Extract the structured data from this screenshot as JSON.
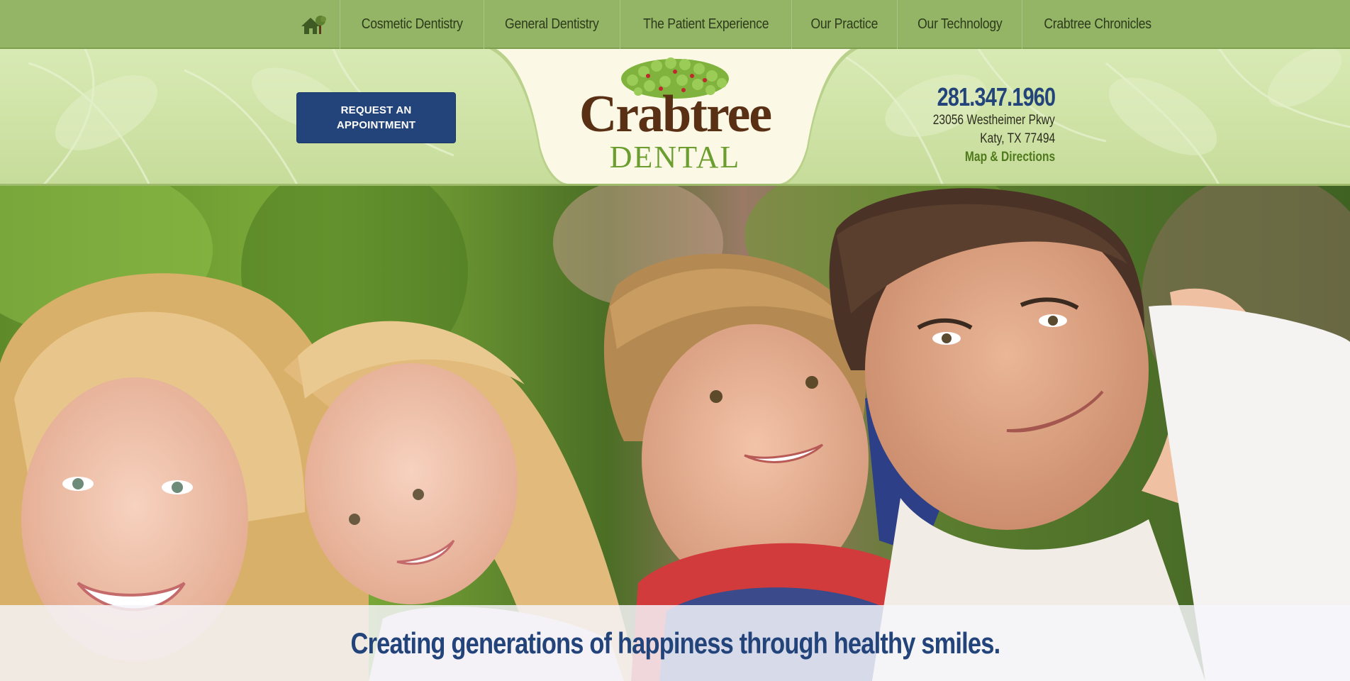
{
  "nav": {
    "home_icon": "home-icon",
    "items": [
      {
        "label": "Cosmetic Dentistry"
      },
      {
        "label": "General Dentistry"
      },
      {
        "label": "The Patient Experience"
      },
      {
        "label": "Our Practice"
      },
      {
        "label": "Our Technology"
      },
      {
        "label": "Crabtree Chronicles"
      }
    ]
  },
  "header": {
    "appointment_label": "REQUEST AN APPOINTMENT",
    "logo": {
      "name": "Crabtree",
      "sub": "DENTAL"
    },
    "contact": {
      "phone": "281.347.1960",
      "address_line1": "23056 Westheimer Pkwy",
      "address_line2": "Katy, TX 77494",
      "map_link": "Map & Directions"
    }
  },
  "hero": {
    "tagline": "Creating generations of happiness through healthy smiles.",
    "image_description_icon": "family-photo"
  },
  "colors": {
    "nav_green": "#93b565",
    "header_green": "#cfe3a8",
    "brand_blue": "#22447a",
    "logo_brown": "#5a3015",
    "logo_green": "#6b9e2f",
    "link_green": "#4f7a1c"
  }
}
